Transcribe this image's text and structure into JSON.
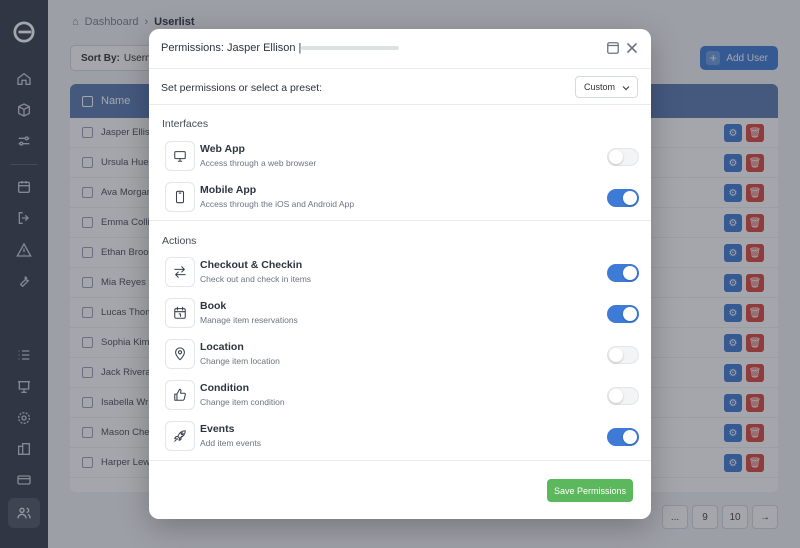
{
  "breadcrumb": {
    "root": "Dashboard",
    "current": "Userlist"
  },
  "toolbar": {
    "sort_label": "Sort By:",
    "sort_value": "Usernam",
    "add_user_label": "Add User"
  },
  "table": {
    "column_name": "Name",
    "rows": [
      {
        "name": "Jasper Elliso"
      },
      {
        "name": "Ursula Huebs"
      },
      {
        "name": "Ava Morgan"
      },
      {
        "name": "Emma Collin"
      },
      {
        "name": "Ethan Brook"
      },
      {
        "name": "Mia Reyes"
      },
      {
        "name": "Lucas Thom"
      },
      {
        "name": "Sophia Kim"
      },
      {
        "name": "Jack Rivera"
      },
      {
        "name": "Isabella Wri"
      },
      {
        "name": "Mason Chen"
      },
      {
        "name": "Harper Lewi"
      }
    ]
  },
  "pagination": {
    "ellipsis": "...",
    "pages": [
      "9",
      "10"
    ]
  },
  "modal": {
    "title": "Permissions: Jasper Ellison |",
    "preset_label": "Set permissions or select a preset:",
    "preset_value": "Custom",
    "interfaces_title": "Interfaces",
    "actions_title": "Actions",
    "interfaces": [
      {
        "name": "Web App",
        "desc": "Access through a web browser",
        "enabled": false,
        "icon": "monitor-icon"
      },
      {
        "name": "Mobile App",
        "desc": "Access through the iOS and Android App",
        "enabled": true,
        "icon": "mobile-icon"
      }
    ],
    "actions": [
      {
        "name": "Checkout & Checkin",
        "desc": "Check out and check in items",
        "enabled": true,
        "icon": "arrows-exchange-icon"
      },
      {
        "name": "Book",
        "desc": "Manage item reservations",
        "enabled": true,
        "icon": "calendar-icon"
      },
      {
        "name": "Location",
        "desc": "Change item location",
        "enabled": false,
        "icon": "map-pin-icon"
      },
      {
        "name": "Condition",
        "desc": "Change item condition",
        "enabled": false,
        "icon": "thumbs-up-icon"
      },
      {
        "name": "Events",
        "desc": "Add item events",
        "enabled": true,
        "icon": "rocket-icon"
      }
    ],
    "save_label": "Save Permissions"
  },
  "colors": {
    "accent": "#3d7bd6",
    "save": "#5cb85c",
    "danger": "#d9473f",
    "sidebar": "#363e4c"
  }
}
